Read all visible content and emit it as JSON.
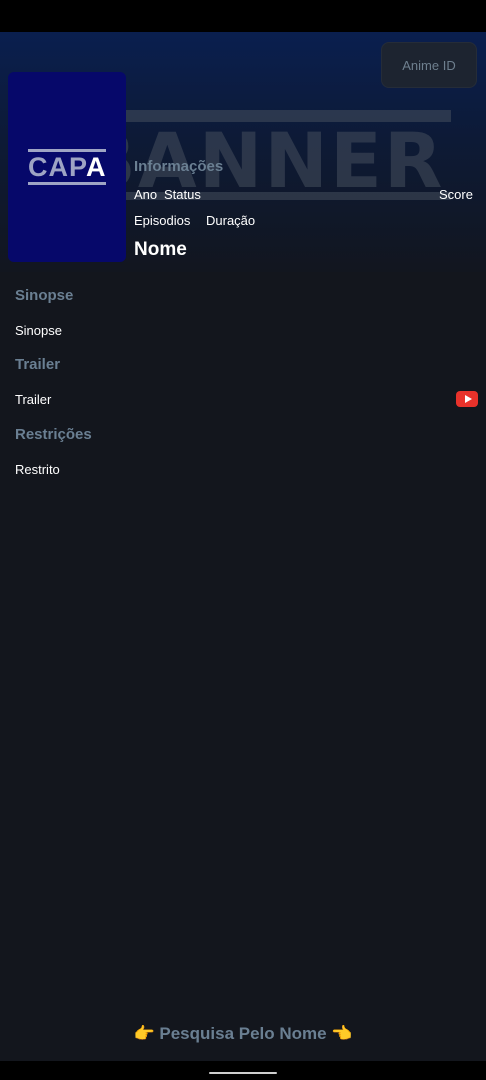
{
  "header": {
    "banner_text": "BANNER",
    "anime_id_button": "Anime ID"
  },
  "cover": {
    "text_main": "CAP",
    "text_accent": "A"
  },
  "info": {
    "heading": "Informações",
    "ano": "Ano",
    "status": "Status",
    "score": "Score",
    "episodios": "Episodios",
    "duracao": "Duração",
    "nome": "Nome"
  },
  "sections": {
    "sinopse_heading": "Sinopse",
    "sinopse_text": "Sinopse",
    "trailer_heading": "Trailer",
    "trailer_text": "Trailer",
    "restricoes_heading": "Restrições",
    "restrito_text": "Restrito"
  },
  "footer": {
    "search_label": "Pesquisa Pelo Nome",
    "emoji_left": "👉",
    "emoji_right": "👈"
  },
  "icons": {
    "trailer": "youtube-icon"
  },
  "colors": {
    "background": "#13161d",
    "banner_top": "#0a1f4f",
    "cover": "#06086a",
    "heading": "#6a7f92",
    "youtube": "#e8322b"
  }
}
